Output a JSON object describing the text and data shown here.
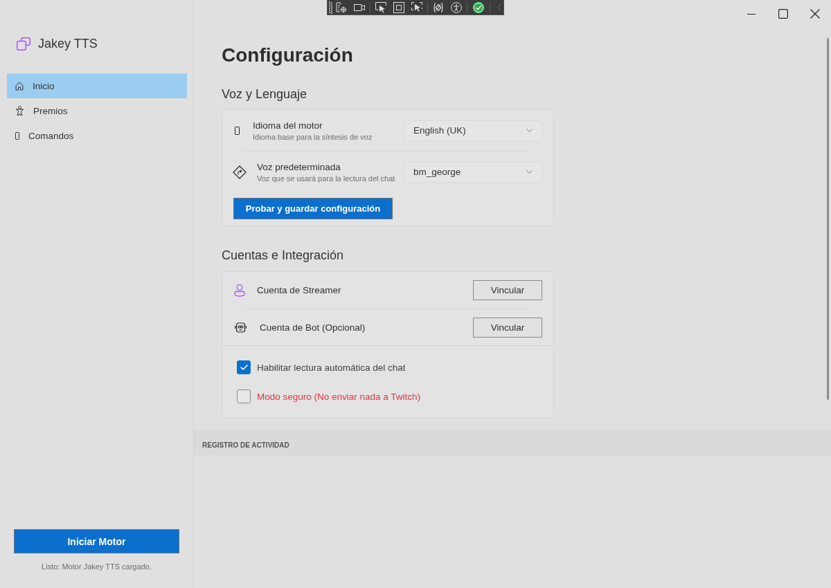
{
  "sidebar": {
    "app_name": "Jakey TTS",
    "items": [
      {
        "label": "Inicio",
        "selected": true
      },
      {
        "label": "Premios",
        "selected": false
      },
      {
        "label": "Comandos",
        "selected": false
      }
    ],
    "start_button": "Iniciar Motor",
    "status": "Listo: Motor Jakey TTS cargado."
  },
  "content": {
    "title": "Configuración",
    "voice_section": {
      "title": "Voz y Lenguaje",
      "settings": [
        {
          "title": "Idioma del motor",
          "description": "Idioma base para la síntesis de voz",
          "value": "English (UK)"
        },
        {
          "title": "Voz predeterminada",
          "description": "Voz que se usará para la lectura del chat",
          "value": "bm_george"
        }
      ],
      "save_button": "Probar y guardar configuración"
    },
    "accounts_section": {
      "title": "Cuentas e Integración",
      "accounts": [
        {
          "label": "Cuenta de Streamer",
          "button": "Vincular"
        },
        {
          "label": "Cuenta de Bot (Opcional)",
          "button": "Vincular"
        }
      ],
      "options": [
        {
          "label": "Habilitar lectura automática del chat",
          "checked": true,
          "kind": "normal"
        },
        {
          "label": "Modo seguro (No enviar nada a Twitch)",
          "checked": false,
          "kind": "warning"
        }
      ]
    }
  },
  "activity_log": {
    "title": "REGISTRO DE ACTIVIDAD"
  }
}
